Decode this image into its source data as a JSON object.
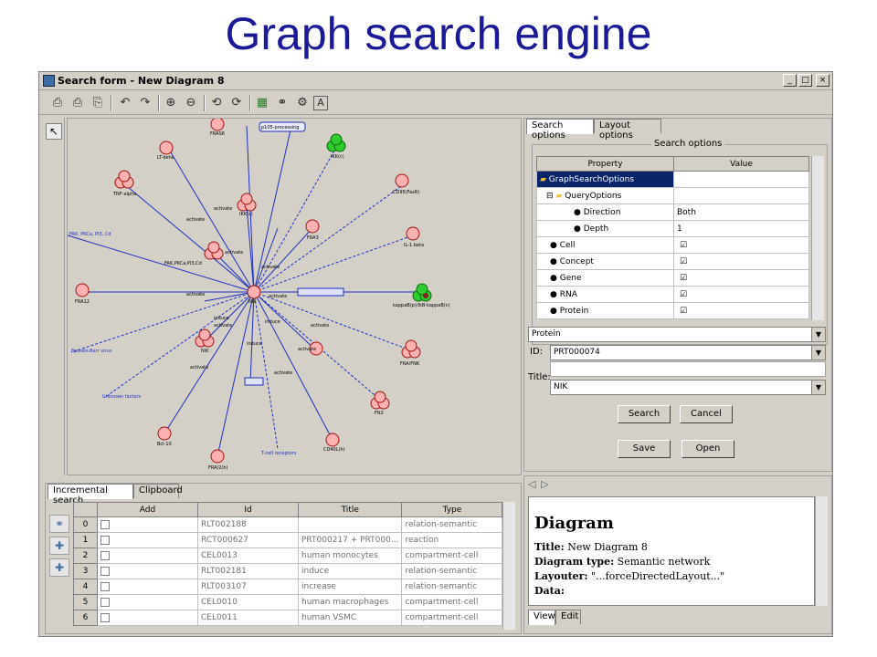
{
  "slide_title": "Graph search engine",
  "window": {
    "title": "Search form - New Diagram 8",
    "controls": {
      "minimize": "_",
      "maximize": "□",
      "close": "×"
    }
  },
  "toolbar": {
    "icons": [
      "print-icon",
      "print-preview-icon",
      "page-setup-icon",
      "undo-icon",
      "redo-icon",
      "zoom-in-icon",
      "zoom-out-icon",
      "rotate-left-icon",
      "rotate-right-icon",
      "layout-icon",
      "find-icon",
      "settings-icon",
      "text-icon"
    ]
  },
  "graph": {
    "edge_labels": [
      "activate",
      "activate",
      "activate",
      "activate",
      "activate",
      "activate",
      "activate",
      "activate",
      "activate",
      "induce",
      "induce",
      "induce",
      "activate",
      "activate"
    ],
    "nodes": [
      {
        "label": "FRAS6"
      },
      {
        "label": "p105-processing"
      },
      {
        "label": "LT-beta"
      },
      {
        "label": "IKK(c)"
      },
      {
        "label": "TNF-alpha"
      },
      {
        "label": "IKK(c)"
      },
      {
        "label": "CD95(FasR)"
      },
      {
        "label": "FRA3"
      },
      {
        "label": "IL-1 beta"
      },
      {
        "label": "FAK, PKCa, PI3, Cd"
      },
      {
        "label": "FAK,PKCa,PI3,Cd"
      },
      {
        "label": "NIK"
      },
      {
        "label": "kappaB(p)/IkB-kappaB(c)"
      },
      {
        "label": "FRA12"
      },
      {
        "label": "Epstein-Barr virus"
      },
      {
        "label": "NIK"
      },
      {
        "label": "FRA/FNK"
      },
      {
        "label": "Unknown factors"
      },
      {
        "label": "FN2"
      },
      {
        "label": "Bcl-10"
      },
      {
        "label": "CD40L(h)"
      },
      {
        "label": "FRA/2(h)"
      },
      {
        "label": "T-cell receptors"
      }
    ]
  },
  "incremental": {
    "tabs": [
      "Incremental search",
      "Clipboard"
    ],
    "columns": [
      "Add",
      "Id",
      "Title",
      "Type"
    ],
    "rows": [
      {
        "n": "0",
        "id": "RLT002188",
        "title": "",
        "type": "relation-semantic"
      },
      {
        "n": "1",
        "id": "RCT000627",
        "title": "PRT000217 + PRT000...",
        "type": "reaction"
      },
      {
        "n": "2",
        "id": "CEL0013",
        "title": "human monocytes",
        "type": "compartment-cell"
      },
      {
        "n": "3",
        "id": "RLT002181",
        "title": "induce",
        "type": "relation-semantic"
      },
      {
        "n": "4",
        "id": "RLT003107",
        "title": "increase",
        "type": "relation-semantic"
      },
      {
        "n": "5",
        "id": "CEL0010",
        "title": "human macrophages",
        "type": "compartment-cell"
      },
      {
        "n": "6",
        "id": "CEL0011",
        "title": "human VSMC",
        "type": "compartment-cell"
      }
    ]
  },
  "search_options": {
    "tabs": [
      "Search options",
      "Layout options"
    ],
    "group_label": "Search options",
    "columns": [
      "Property",
      "Value"
    ],
    "rows": [
      {
        "name": "GraphSearchOptions",
        "value": ""
      },
      {
        "name": "QueryOptions",
        "value": ""
      },
      {
        "name": "Direction",
        "value": "Both"
      },
      {
        "name": "Depth",
        "value": "1"
      },
      {
        "name": "Cell",
        "value": "☑"
      },
      {
        "name": "Concept",
        "value": "☑"
      },
      {
        "name": "Gene",
        "value": "☑"
      },
      {
        "name": "RNA",
        "value": "☑"
      },
      {
        "name": "Protein",
        "value": "☑"
      }
    ],
    "type_select": "Protein",
    "id_label": "ID:",
    "id_value": "PRT000074",
    "title_label": "Title:",
    "title_value": "NIK",
    "buttons": {
      "search": "Search",
      "cancel": "Cancel",
      "save": "Save",
      "open": "Open"
    }
  },
  "doc": {
    "heading": "Diagram",
    "title_label": "Title:",
    "title_value": "New Diagram 8",
    "type_label": "Diagram type:",
    "type_value": "Semantic network",
    "layouter_label": "Layouter:",
    "layouter_value": "\"...forceDirectedLayout...\"",
    "data_label": "Data:",
    "tabs": [
      "View",
      "Edit"
    ]
  }
}
